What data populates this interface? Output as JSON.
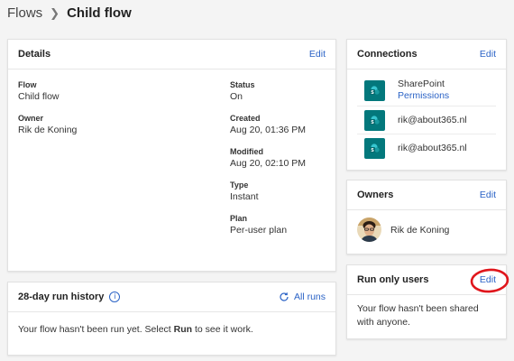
{
  "breadcrumb": {
    "parent": "Flows",
    "current": "Child flow"
  },
  "details": {
    "title": "Details",
    "edit_label": "Edit",
    "left_fields": [
      {
        "label": "Flow",
        "value": "Child flow"
      },
      {
        "label": "Owner",
        "value": "Rik de Koning"
      }
    ],
    "right_fields": [
      {
        "label": "Status",
        "value": "On"
      },
      {
        "label": "Created",
        "value": "Aug 20, 01:36 PM"
      },
      {
        "label": "Modified",
        "value": "Aug 20, 02:10 PM"
      },
      {
        "label": "Type",
        "value": "Instant"
      },
      {
        "label": "Plan",
        "value": "Per-user plan"
      }
    ]
  },
  "run_history": {
    "title": "28-day run history",
    "all_runs_label": "All runs",
    "message_prefix": "Your flow hasn't been run yet. Select ",
    "message_bold": "Run",
    "message_suffix": " to see it work."
  },
  "connections": {
    "title": "Connections",
    "edit_label": "Edit",
    "items": [
      {
        "name": "SharePoint",
        "sub": "Permissions"
      },
      {
        "name": "rik@about365.nl"
      },
      {
        "name": "rik@about365.nl"
      }
    ]
  },
  "owners": {
    "title": "Owners",
    "edit_label": "Edit",
    "items": [
      {
        "name": "Rik de Koning"
      }
    ]
  },
  "run_only_users": {
    "title": "Run only users",
    "edit_label": "Edit",
    "message": "Your flow hasn't been shared with anyone."
  },
  "colors": {
    "accent": "#2b63c6",
    "sharepoint": "#03787c",
    "annotation": "#e0161c"
  }
}
